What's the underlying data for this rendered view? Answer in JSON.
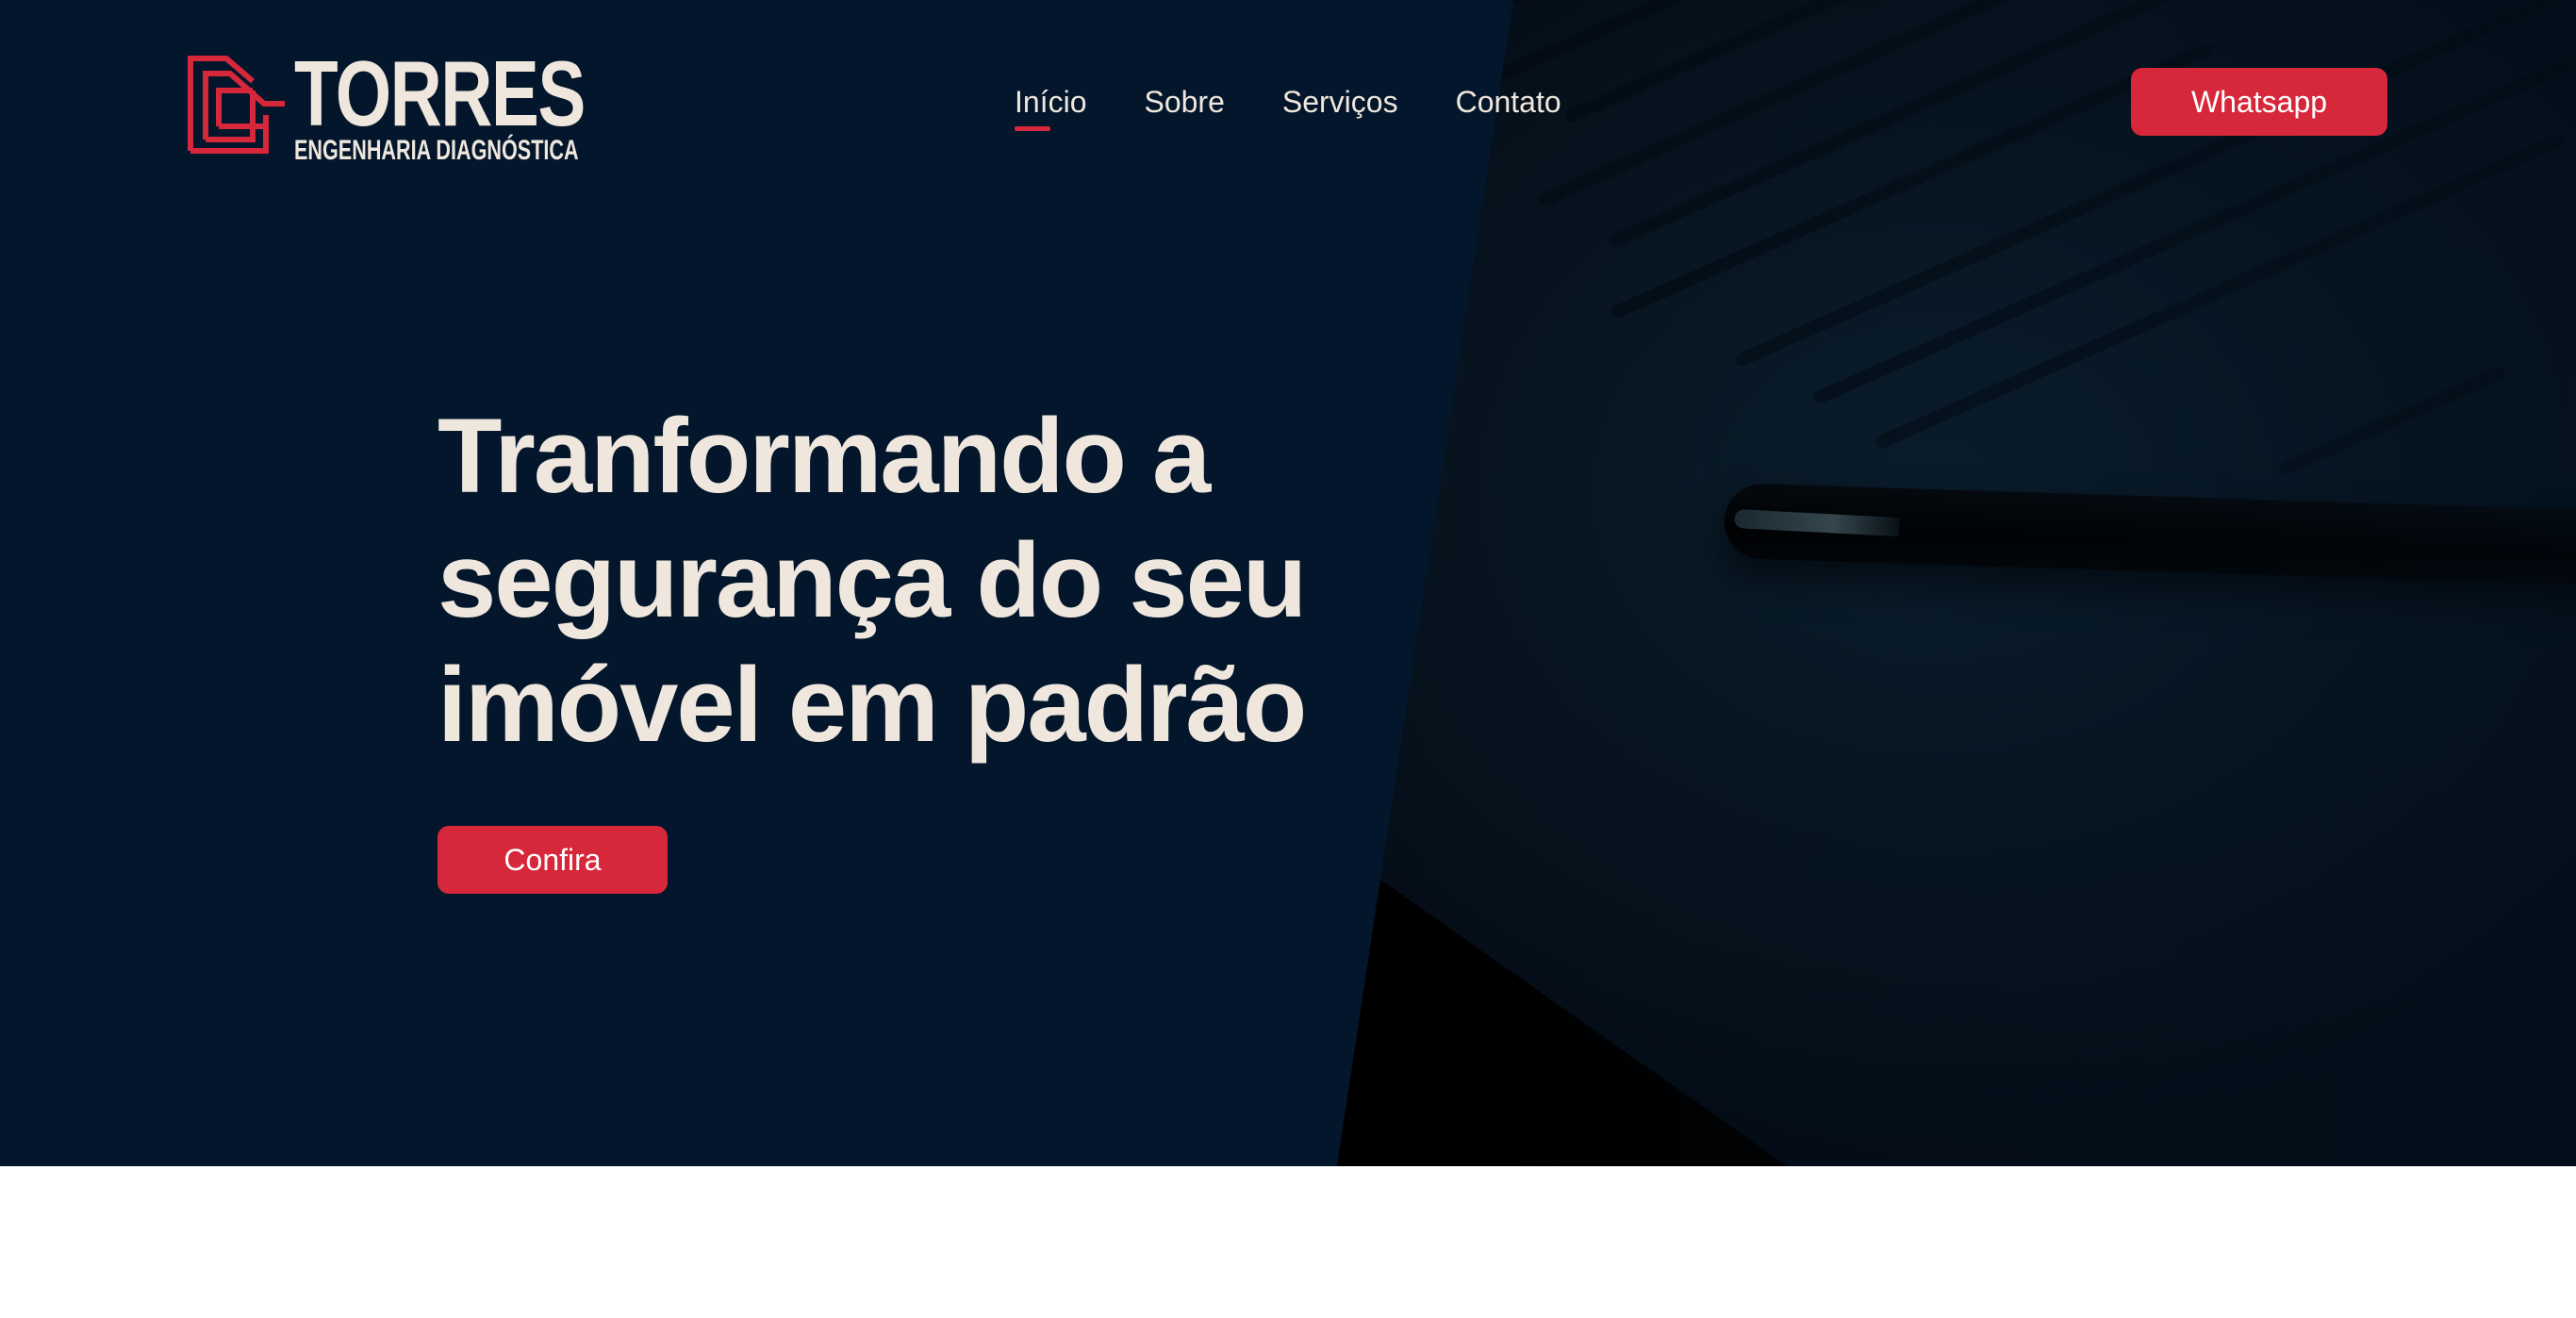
{
  "brand": {
    "name": "TORRES",
    "tagline": "ENGENHARIA DIAGNÓSTICA",
    "accent_color": "#d7273a",
    "text_color": "#efe7dd",
    "background_color": "#03162b",
    "logo_icon": "house-outline-icon"
  },
  "nav": {
    "items": [
      {
        "label": "Início",
        "active": true
      },
      {
        "label": "Sobre",
        "active": false
      },
      {
        "label": "Serviços",
        "active": false
      },
      {
        "label": "Contato",
        "active": false
      }
    ]
  },
  "header": {
    "cta_label": "Whatsapp"
  },
  "hero": {
    "title_lines": [
      "Tranformando a",
      "segurança do seu",
      "imóvel em padrão"
    ],
    "cta_label": "Confira"
  }
}
